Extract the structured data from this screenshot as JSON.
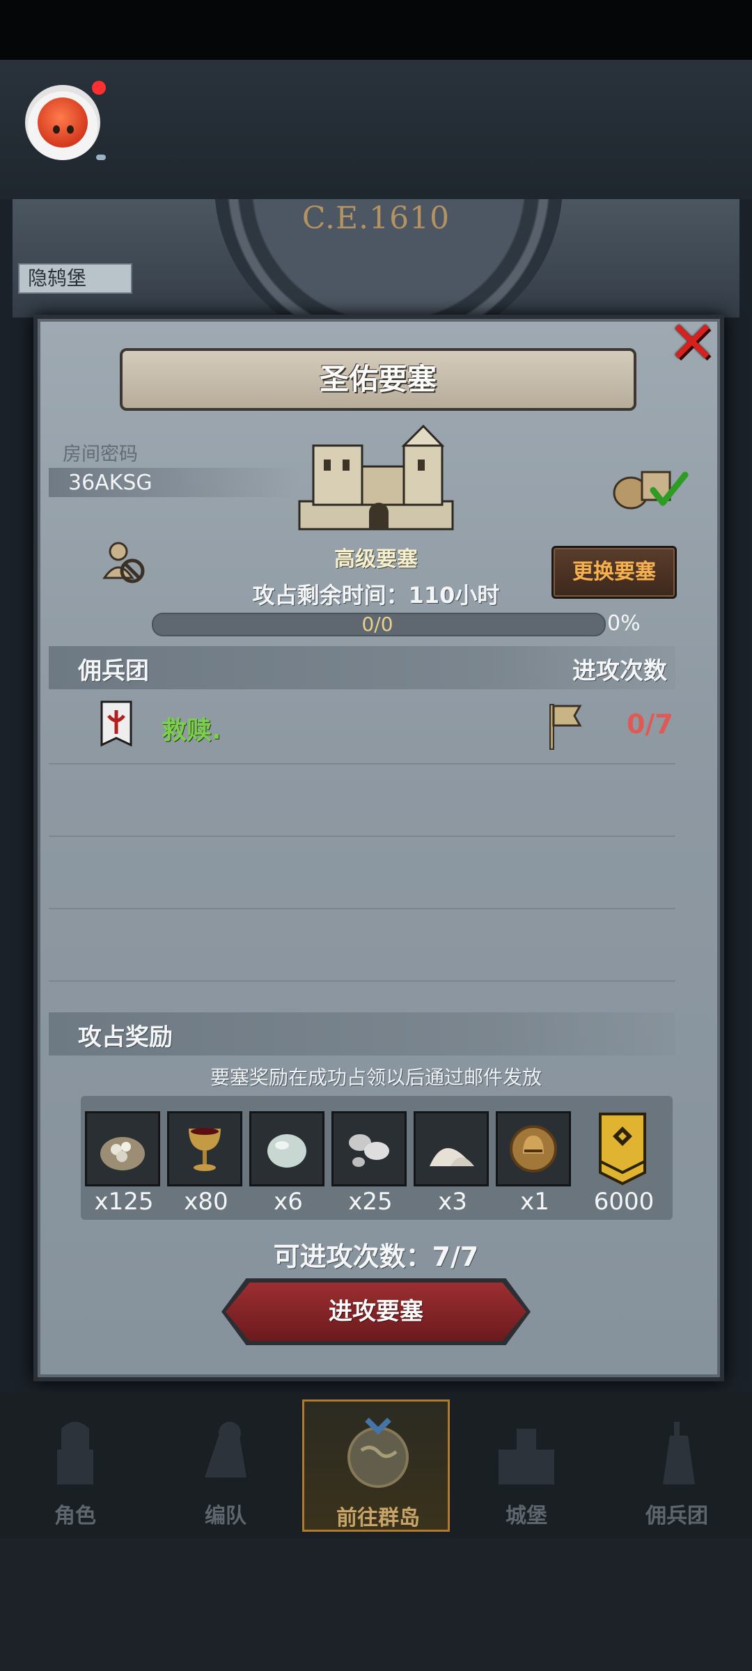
{
  "map": {
    "year": "C.E.1610",
    "tag": "隐鸫堡"
  },
  "dialog": {
    "title": "圣佑要塞",
    "room_label": "房间密码",
    "room_code": "36AKSG",
    "fortress_level": "高级要塞",
    "change_button": "更换要塞",
    "remaining_time": "攻占剩余时间：110小时",
    "progress": {
      "text": "0/0",
      "percent_text": "0%",
      "fraction": 0
    },
    "mercenary_header": "佣兵团",
    "attacks_header": "进攻次数",
    "mercenaries": [
      {
        "name": "救赎.",
        "attacks": "0/7"
      }
    ],
    "rewards_header": "攻占奖励",
    "reward_note": "要塞奖励在成功占领以后通过邮件发放",
    "rewards": [
      {
        "icon": "stone-sack-icon",
        "qty": "x125"
      },
      {
        "icon": "goblet-icon",
        "qty": "x80"
      },
      {
        "icon": "gem-stone-icon",
        "qty": "x6"
      },
      {
        "icon": "silver-ore-icon",
        "qty": "x25"
      },
      {
        "icon": "salt-pile-icon",
        "qty": "x3"
      },
      {
        "icon": "knight-helmet-icon",
        "qty": "x1"
      },
      {
        "icon": "honor-medal-icon",
        "qty": "6000"
      }
    ],
    "attempts": "可进攻次数：7/7",
    "attack_button": "进攻要塞"
  },
  "nav": [
    {
      "label": "角色",
      "icon": "knight-icon",
      "active": false
    },
    {
      "label": "编队",
      "icon": "formation-icon",
      "active": false
    },
    {
      "label": "前往群岛",
      "icon": "globe-icon",
      "active": true
    },
    {
      "label": "城堡",
      "icon": "castle-icon",
      "active": false
    },
    {
      "label": "佣兵团",
      "icon": "mercenary-icon",
      "active": false
    }
  ],
  "colors": {
    "accent_gold": "#c8a468",
    "attack_red": "#9c2f31",
    "merc_green": "#7bd04a"
  }
}
